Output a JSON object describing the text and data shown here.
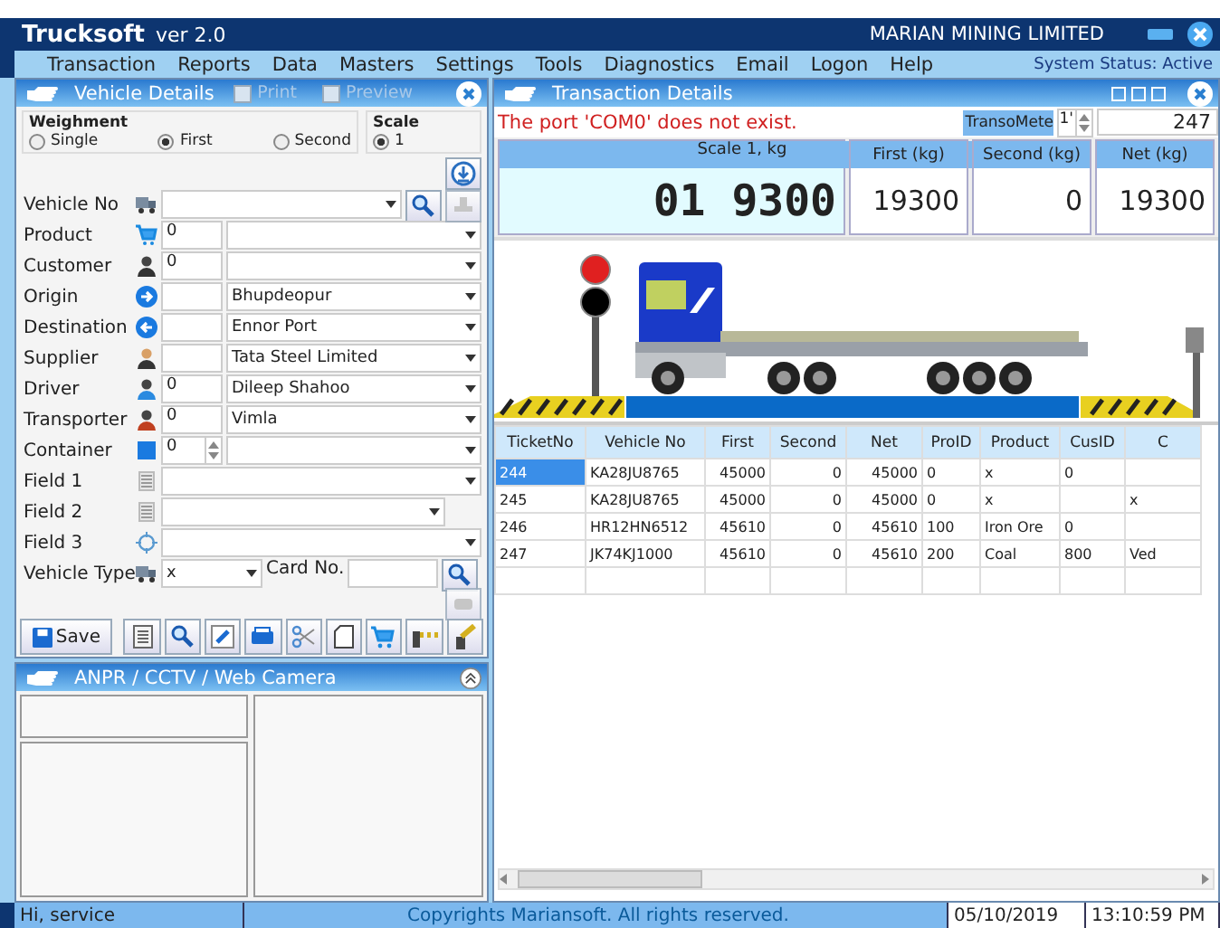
{
  "app": {
    "name": "Trucksoft",
    "version": "ver 2.0",
    "company": "MARIAN MINING LIMITED"
  },
  "menu": [
    "Transaction",
    "Reports",
    "Data",
    "Masters",
    "Settings",
    "Tools",
    "Diagnostics",
    "Email",
    "Logon",
    "Help"
  ],
  "system_status": "System Status: Active",
  "vehicle_panel": {
    "title": "Vehicle Details",
    "print": {
      "label": "Print",
      "checked": false,
      "disabled": true
    },
    "preview": {
      "label": "Preview",
      "checked": false,
      "disabled": true
    },
    "weighment": {
      "label": "Weighment",
      "options": [
        {
          "label": "Single",
          "selected": false
        },
        {
          "label": "First",
          "selected": true
        },
        {
          "label": "Second",
          "selected": false
        }
      ]
    },
    "scale": {
      "label": "Scale",
      "options": [
        {
          "label": "1",
          "selected": true
        }
      ]
    },
    "fields": [
      {
        "kind": "vehicle",
        "label": "Vehicle No"
      },
      {
        "kind": "combo",
        "label": "Product",
        "code": "0"
      },
      {
        "kind": "combo",
        "label": "Customer",
        "code": "0"
      },
      {
        "kind": "combo",
        "label": "Origin",
        "value": "Bhupdeopur"
      },
      {
        "kind": "combo",
        "label": "Destination",
        "value": "Ennor Port"
      },
      {
        "kind": "combo",
        "label": "Supplier",
        "value": "Tata Steel Limited"
      },
      {
        "kind": "combo",
        "label": "Driver",
        "code": "0",
        "value": "Dileep Shahoo"
      },
      {
        "kind": "combo",
        "label": "Transporter",
        "code": "0",
        "value": "Vimla"
      },
      {
        "kind": "spin",
        "label": "Container",
        "code": "0"
      },
      {
        "kind": "wide",
        "label": "Field 1"
      },
      {
        "kind": "short",
        "label": "Field 2"
      },
      {
        "kind": "wide",
        "label": "Field 3"
      },
      {
        "kind": "type",
        "label": "Vehicle Type",
        "value": "x",
        "card_label": "Card No."
      }
    ]
  },
  "toolbar": {
    "save": "Save"
  },
  "camera_panel": {
    "title": "ANPR / CCTV / Web Camera"
  },
  "transaction_panel": {
    "title": "Transaction Details",
    "error": "The port 'COM0' does not exist.",
    "meter": {
      "label": "TransoMete",
      "spin": "1'",
      "value": "247"
    },
    "scale": {
      "label": "Scale 1, kg",
      "value": "01 9300"
    },
    "weights": [
      {
        "label": "First (kg)",
        "value": "19300"
      },
      {
        "label": "Second (kg)",
        "value": "0"
      },
      {
        "label": "Net (kg)",
        "value": "19300"
      }
    ],
    "signal_red": true
  },
  "table": {
    "columns": [
      "TicketNo",
      "Vehicle No",
      "First",
      "Second",
      "Net",
      "ProID",
      "Product",
      "CusID",
      "C"
    ],
    "rows": [
      {
        "selected": true,
        "cells": [
          "244",
          "KA28JU8765",
          "45000",
          "0",
          "45000",
          "0",
          "x",
          "0",
          ""
        ]
      },
      {
        "selected": false,
        "cells": [
          "245",
          "KA28JU8765",
          "45000",
          "0",
          "45000",
          "0",
          "x",
          "",
          "x"
        ]
      },
      {
        "selected": false,
        "cells": [
          "246",
          "HR12HN6512",
          "45610",
          "0",
          "45610",
          "100",
          "Iron Ore",
          "0",
          ""
        ]
      },
      {
        "selected": false,
        "cells": [
          "247",
          "JK74KJ1000",
          "45610",
          "0",
          "45610",
          "200",
          "Coal",
          "800",
          "Ved"
        ]
      }
    ]
  },
  "status_bar": {
    "user": "Hi, service",
    "copyright": "Copyrights Mariansoft. All rights reserved.",
    "date": "05/10/2019",
    "time": "13:10:59 PM"
  }
}
